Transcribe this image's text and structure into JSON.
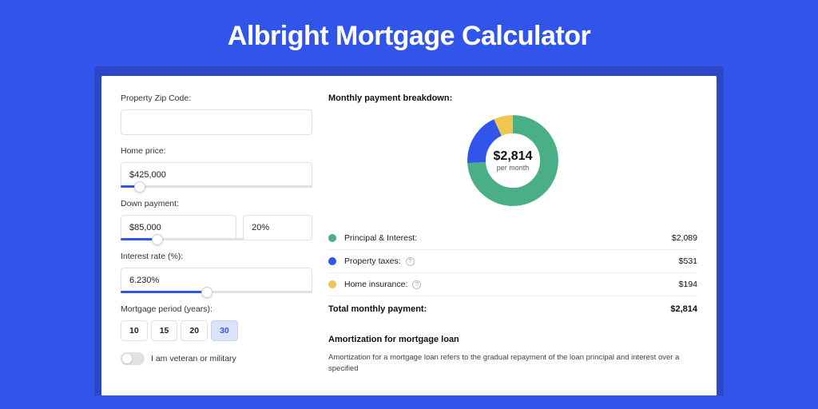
{
  "page": {
    "title": "Albright Mortgage Calculator"
  },
  "form": {
    "zip_label": "Property Zip Code:",
    "zip_value": "",
    "home_price_label": "Home price:",
    "home_price_value": "$425,000",
    "home_price_slider_pct": 10,
    "down_payment_label": "Down payment:",
    "down_payment_value": "$85,000",
    "down_payment_pct": "20%",
    "down_payment_slider_pct": 30,
    "interest_label": "Interest rate (%):",
    "interest_value": "6.230%",
    "interest_slider_pct": 45,
    "period_label": "Mortgage period (years):",
    "period_options": [
      "10",
      "15",
      "20",
      "30"
    ],
    "period_selected": "30",
    "veteran_label": "I am veteran or military",
    "veteran_on": false
  },
  "breakdown": {
    "title": "Monthly payment breakdown:",
    "center_value": "$2,814",
    "center_sub": "per month",
    "items": [
      {
        "label": "Principal & Interest:",
        "value": "$2,089",
        "color": "#4aaf87",
        "pct": 74,
        "info": false
      },
      {
        "label": "Property taxes:",
        "value": "$531",
        "color": "#3155eb",
        "pct": 19,
        "info": true
      },
      {
        "label": "Home insurance:",
        "value": "$194",
        "color": "#f0c64f",
        "pct": 7,
        "info": true
      }
    ],
    "total_label": "Total monthly payment:",
    "total_value": "$2,814"
  },
  "chart_data": {
    "type": "pie",
    "title": "Monthly payment breakdown",
    "series": [
      {
        "name": "Principal & Interest",
        "value": 2089,
        "color": "#4aaf87"
      },
      {
        "name": "Property taxes",
        "value": 531,
        "color": "#3155eb"
      },
      {
        "name": "Home insurance",
        "value": 194,
        "color": "#f0c64f"
      }
    ],
    "center_label": "$2,814 per month",
    "total": 2814
  },
  "amortization": {
    "title": "Amortization for mortgage loan",
    "text": "Amortization for a mortgage loan refers to the gradual repayment of the loan principal and interest over a specified"
  }
}
